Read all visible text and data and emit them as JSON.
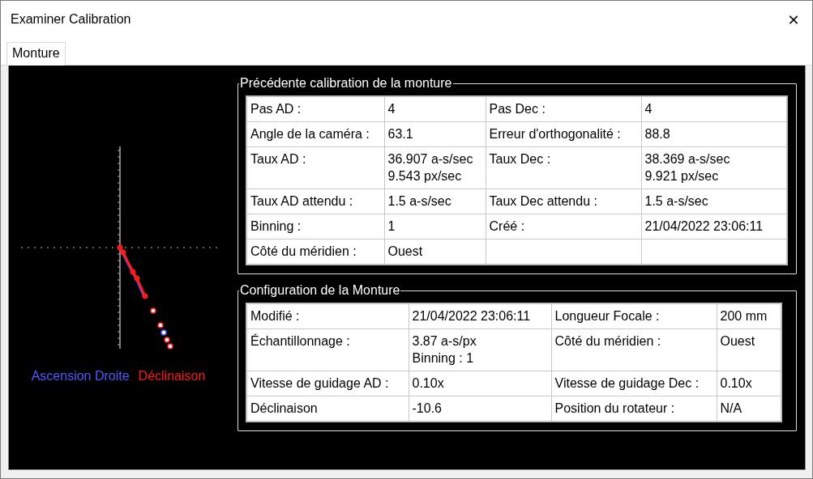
{
  "window": {
    "title": "Examiner Calibration",
    "close": "✕"
  },
  "tabs": [
    {
      "label": "Monture",
      "selected": true
    }
  ],
  "plot": {
    "kind": "picture",
    "legend": [
      {
        "label": "Ascension Droite",
        "color": "#4f5bff"
      },
      {
        "label": "Déclinaison",
        "color": "#ff1a1a"
      }
    ]
  },
  "groups": [
    {
      "title": "Précédente calibration de la monture",
      "rows": [
        [
          "Pas AD :",
          "4",
          "Pas Dec :",
          "4"
        ],
        [
          "Angle de la caméra :",
          "63.1",
          "Erreur d'orthogonalité :",
          "88.8"
        ],
        [
          "Taux AD :",
          "36.907 a-s/sec\n9.543 px/sec",
          "Taux Dec :",
          "38.369 a-s/sec\n9.921 px/sec"
        ],
        [
          "Taux AD attendu :",
          "1.5 a-s/sec",
          "Taux Dec attendu :",
          "1.5 a-s/sec"
        ],
        [
          "Binning :",
          "1",
          "Créé :",
          "21/04/2022 23:06:11"
        ],
        [
          "Côté du méridien :",
          "Ouest",
          "",
          ""
        ]
      ]
    },
    {
      "title": "Configuration de la Monture",
      "rows": [
        [
          "Modifié :",
          "21/04/2022 23:06:11",
          "Longueur Focale :",
          "200 mm"
        ],
        [
          "Échantillonnage :",
          "3.87 a-s/px\nBinning : 1",
          "Côté du méridien :",
          "Ouest"
        ],
        [
          "Vitesse de guidage AD :",
          "0.10x",
          "Vitesse de guidage Dec :",
          "0.10x"
        ],
        [
          "Déclinaison",
          "-10.6",
          "Position du rotateur :",
          "N/A"
        ]
      ]
    }
  ]
}
